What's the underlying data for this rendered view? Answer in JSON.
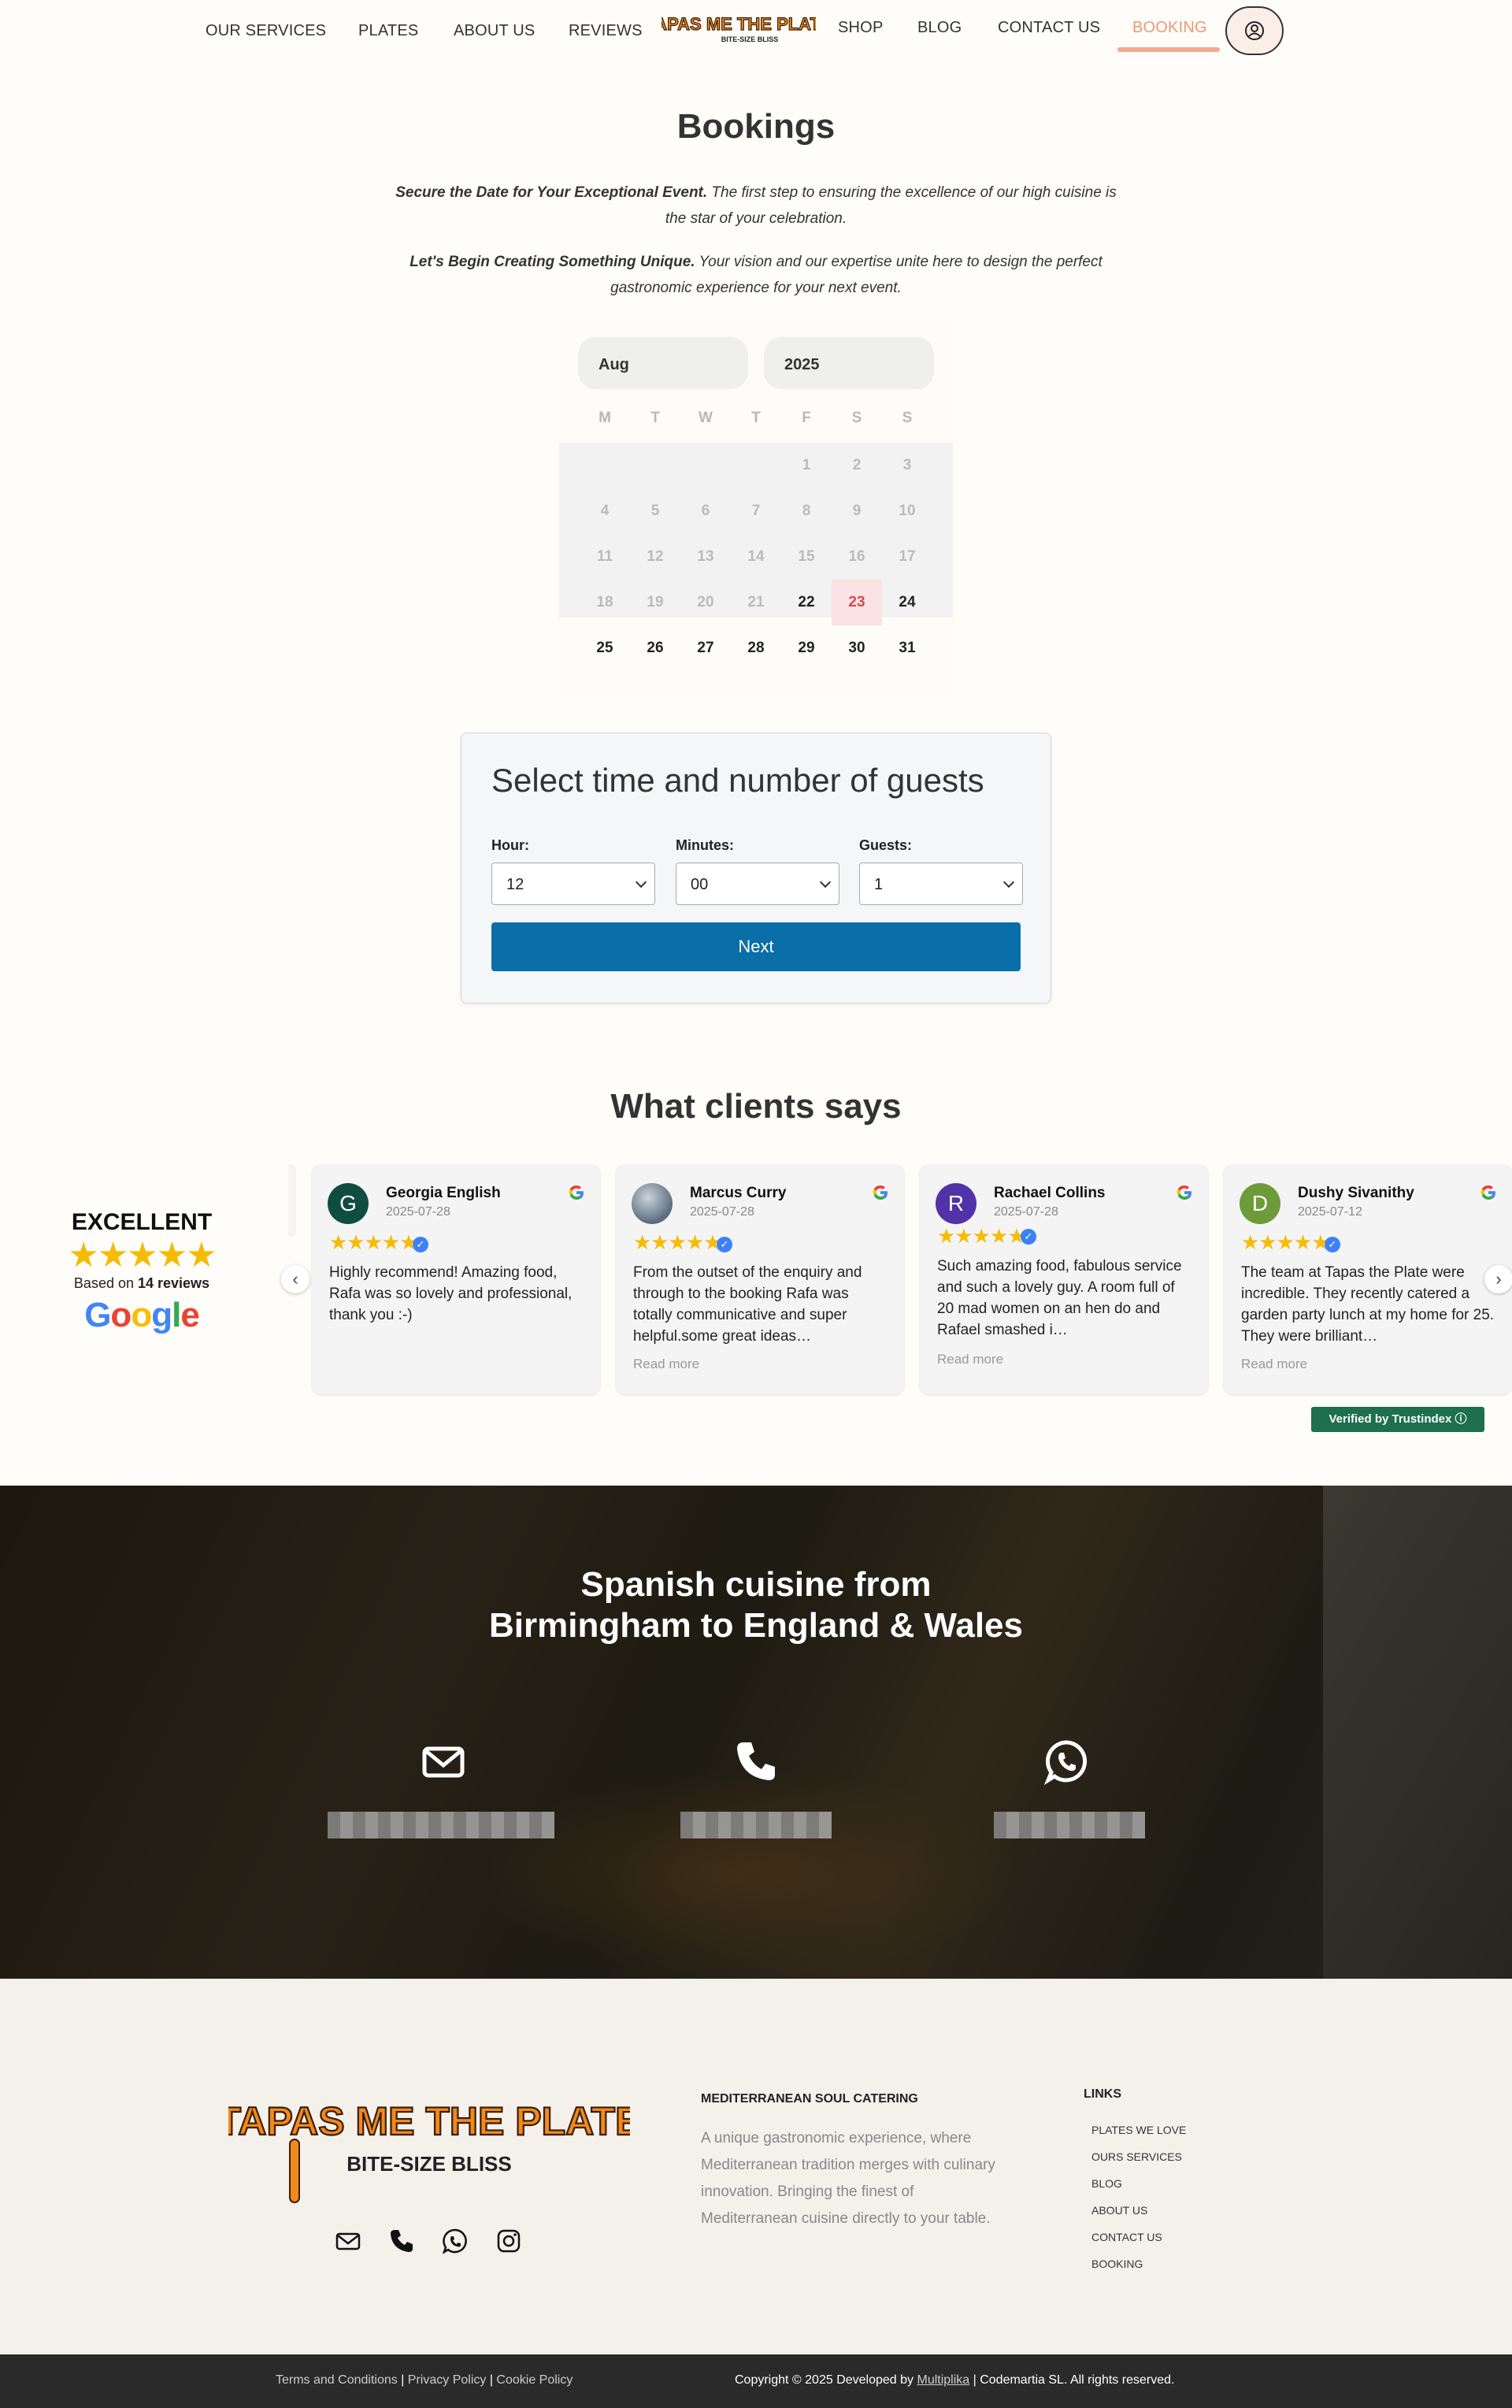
{
  "nav": {
    "items": [
      "OUR SERVICES",
      "PLATES",
      "ABOUT US",
      "REVIEWS",
      "SHOP",
      "BLOG",
      "CONTACT US",
      "BOOKING"
    ],
    "logo_title": "TAPAS ME THE PLATE",
    "logo_subtitle": "BITE-SIZE BLISS",
    "accent": "#ec9a78"
  },
  "booking": {
    "title": "Bookings",
    "intro1_bold": "Secure the Date for Your Exceptional Event.",
    "intro1_text": " The first step to ensuring the excellence of our high cuisine is the star of your celebration.",
    "intro2_bold": "Let's Begin Creating Something Unique.",
    "intro2_text": " Your vision and our expertise unite here to design the perfect gastronomic experience for your next event."
  },
  "calendar": {
    "month": "Aug",
    "year": "2025",
    "weekdays": [
      "M",
      "T",
      "W",
      "T",
      "F",
      "S",
      "S"
    ],
    "days": [
      "1",
      "2",
      "3",
      "4",
      "5",
      "6",
      "7",
      "8",
      "9",
      "10",
      "11",
      "12",
      "13",
      "14",
      "15",
      "16",
      "17",
      "18",
      "19",
      "20",
      "21",
      "22",
      "23",
      "24",
      "25",
      "26",
      "27",
      "28",
      "29",
      "30",
      "31"
    ],
    "first_weekday_index": 4,
    "today": "23",
    "first_available": "22"
  },
  "time_form": {
    "title": "Select time and number of guests",
    "hour_label": "Hour:",
    "hour_value": "12",
    "minutes_label": "Minutes:",
    "minutes_value": "00",
    "guests_label": "Guests:",
    "guests_value": "1",
    "next_label": "Next",
    "button_color": "#0a6ea8"
  },
  "reviews": {
    "title": "What clients says",
    "summary": {
      "rating_word": "EXCELLENT",
      "stars": "★★★★★",
      "based_prefix": "Based on ",
      "based_count": "14 reviews",
      "platform": "Google"
    },
    "cards": [
      {
        "initial": "G",
        "name": "Georgia English",
        "date": "2025-07-28",
        "stars": "★★★★★",
        "text": "Highly recommend! Amazing food, Rafa was so lovely and professional, thank you :-)",
        "read_more": "",
        "color": "#0f4d3f"
      },
      {
        "initial": "",
        "name": "Marcus Curry",
        "date": "2025-07-28",
        "stars": "★★★★★",
        "text": "From the outset of the enquiry and through to the booking Rafa was totally communicative and super helpful.some great ideas…",
        "read_more": "Read more",
        "color": "#7b8a9a"
      },
      {
        "initial": "R",
        "name": "Rachael Collins",
        "date": "2025-07-28",
        "stars": "★★★★★",
        "text": "Such amazing food, fabulous service and such a lovely guy. A room full of 20 mad women on an hen do and Rafael smashed i…",
        "read_more": "Read more",
        "color": "#5232a8"
      },
      {
        "initial": "D",
        "name": "Dushy Sivanithy",
        "date": "2025-07-12",
        "stars": "★★★★★",
        "text": "The team at Tapas the Plate were incredible. They recently catered a garden party lunch at my home for 25. They were brilliant…",
        "read_more": "Read more",
        "color": "#6d9b3a"
      }
    ],
    "verified": "Verified by Trustindex ⓘ",
    "star_color": "#f6bb06"
  },
  "hero": {
    "heading_line1": "Spanish cuisine from",
    "heading_line2": "Birmingham to England & Wales",
    "contacts": [
      "mail-icon",
      "phone-icon",
      "whatsapp-icon"
    ]
  },
  "footer": {
    "logo_title": "TAPAS ME THE PLATE",
    "logo_subtitle": "BITE-SIZE BLISS",
    "about_heading": "MEDITERRANEAN SOUL CATERING",
    "about_text": "A unique gastronomic experience, where Mediterranean tradition merges with culinary innovation. Bringing the finest of Mediterranean cuisine directly to your table.",
    "links_heading": "LINKS",
    "links": [
      "PLATES WE LOVE",
      "OURS SERVICES",
      "BLOG",
      "ABOUT US",
      "CONTACT US",
      "BOOKING"
    ],
    "social": [
      "mail-icon",
      "phone-icon",
      "whatsapp-icon",
      "instagram-icon"
    ]
  },
  "bottom_bar": {
    "terms": "Terms and Conditions",
    "privacy": "Privacy Policy",
    "cookie": "Cookie Policy",
    "sep": " | ",
    "copyright_prefix": "Copyright © 2025 Developed by ",
    "developer": "Multiplika",
    "copyright_suffix": " | Codemartia SL. All rights reserved."
  }
}
